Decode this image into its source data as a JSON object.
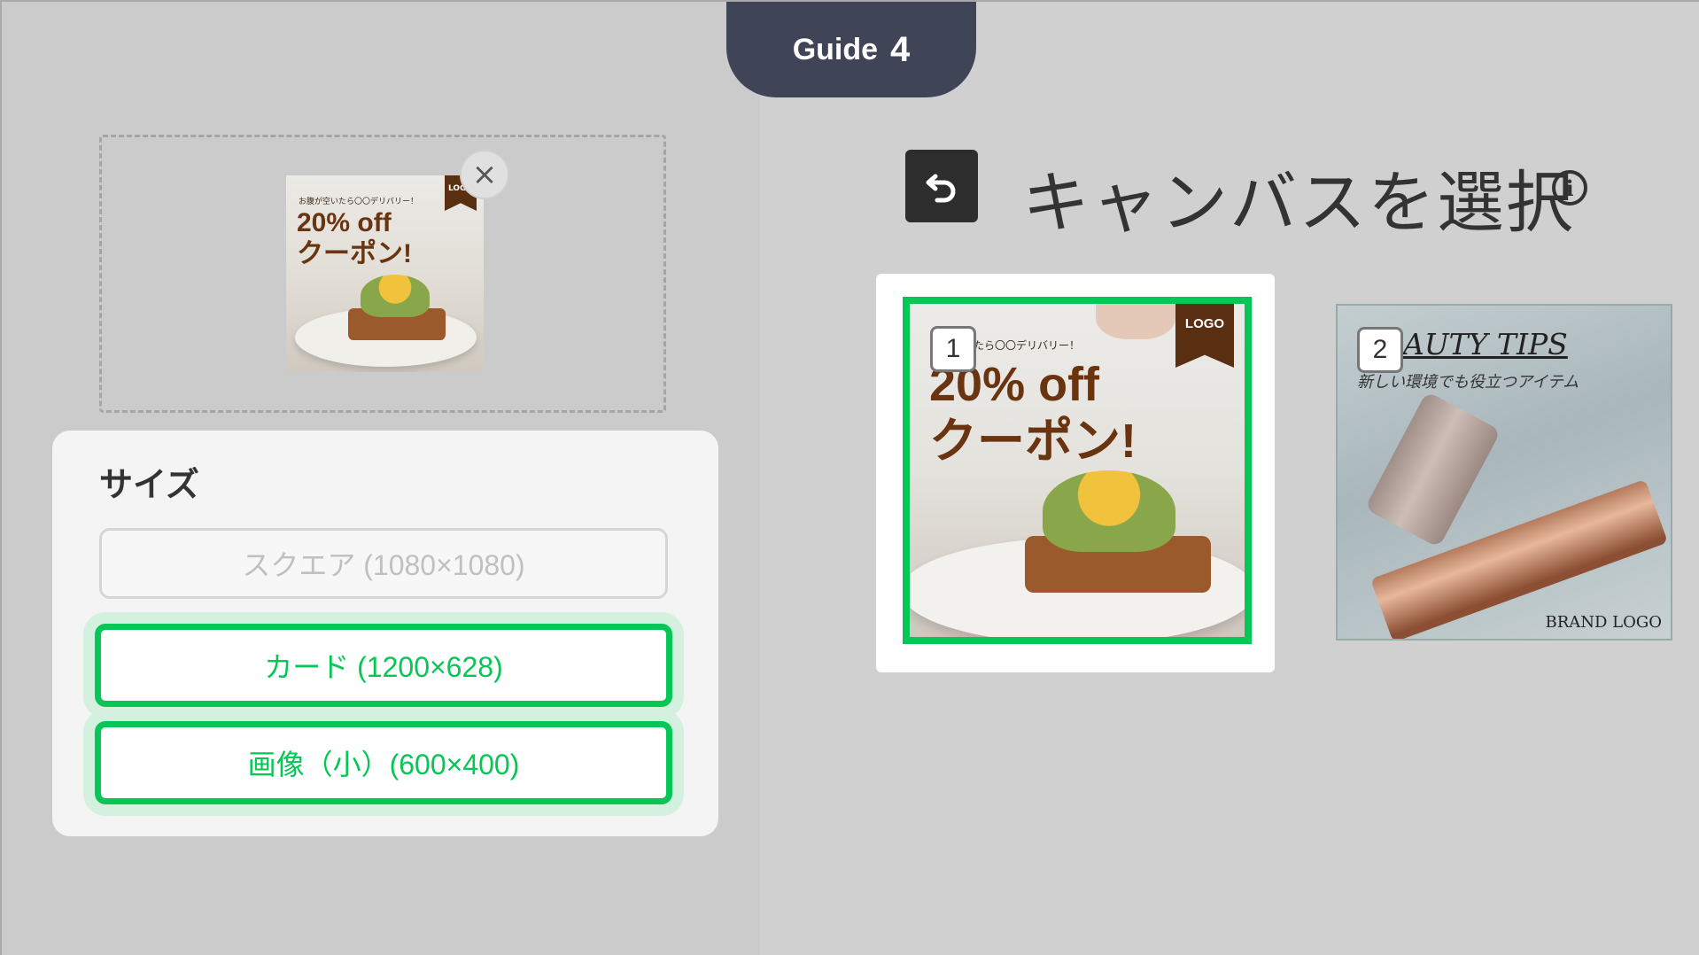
{
  "guide": {
    "label": "Guide",
    "number": "4"
  },
  "preview": {
    "thumb_small_text": "お腹が空いたら〇〇デリバリー！",
    "thumb_big_text": "20% off\nクーポン!",
    "thumb_logo": "LOGO",
    "close_glyph": "×"
  },
  "size_panel": {
    "title": "サイズ",
    "options": [
      {
        "label": "スクエア (1080×1080)",
        "state": "disabled"
      },
      {
        "label": "カード (1200×628)",
        "state": "highlighted"
      },
      {
        "label": "画像（小）(600×400)",
        "state": "highlighted"
      }
    ]
  },
  "header": {
    "title": "キャンバスを選択",
    "back_icon": "undo-arrow-icon",
    "info_icon": "info-icon",
    "info_glyph": "i"
  },
  "canvases": [
    {
      "number": "1",
      "small_text": "いたら〇〇デリバリー！",
      "big_text": "20% off\nクーポン!",
      "logo": "LOGO",
      "selected": true
    },
    {
      "number": "2",
      "title": "AUTY TIPS",
      "subtitle": "新しい環境でも役立つアイテム",
      "brand": "BRAND LOGO",
      "selected": false
    }
  ],
  "colors": {
    "accent": "#06c755",
    "guide_bg": "#404457",
    "logo_brown": "#5a2e10"
  }
}
